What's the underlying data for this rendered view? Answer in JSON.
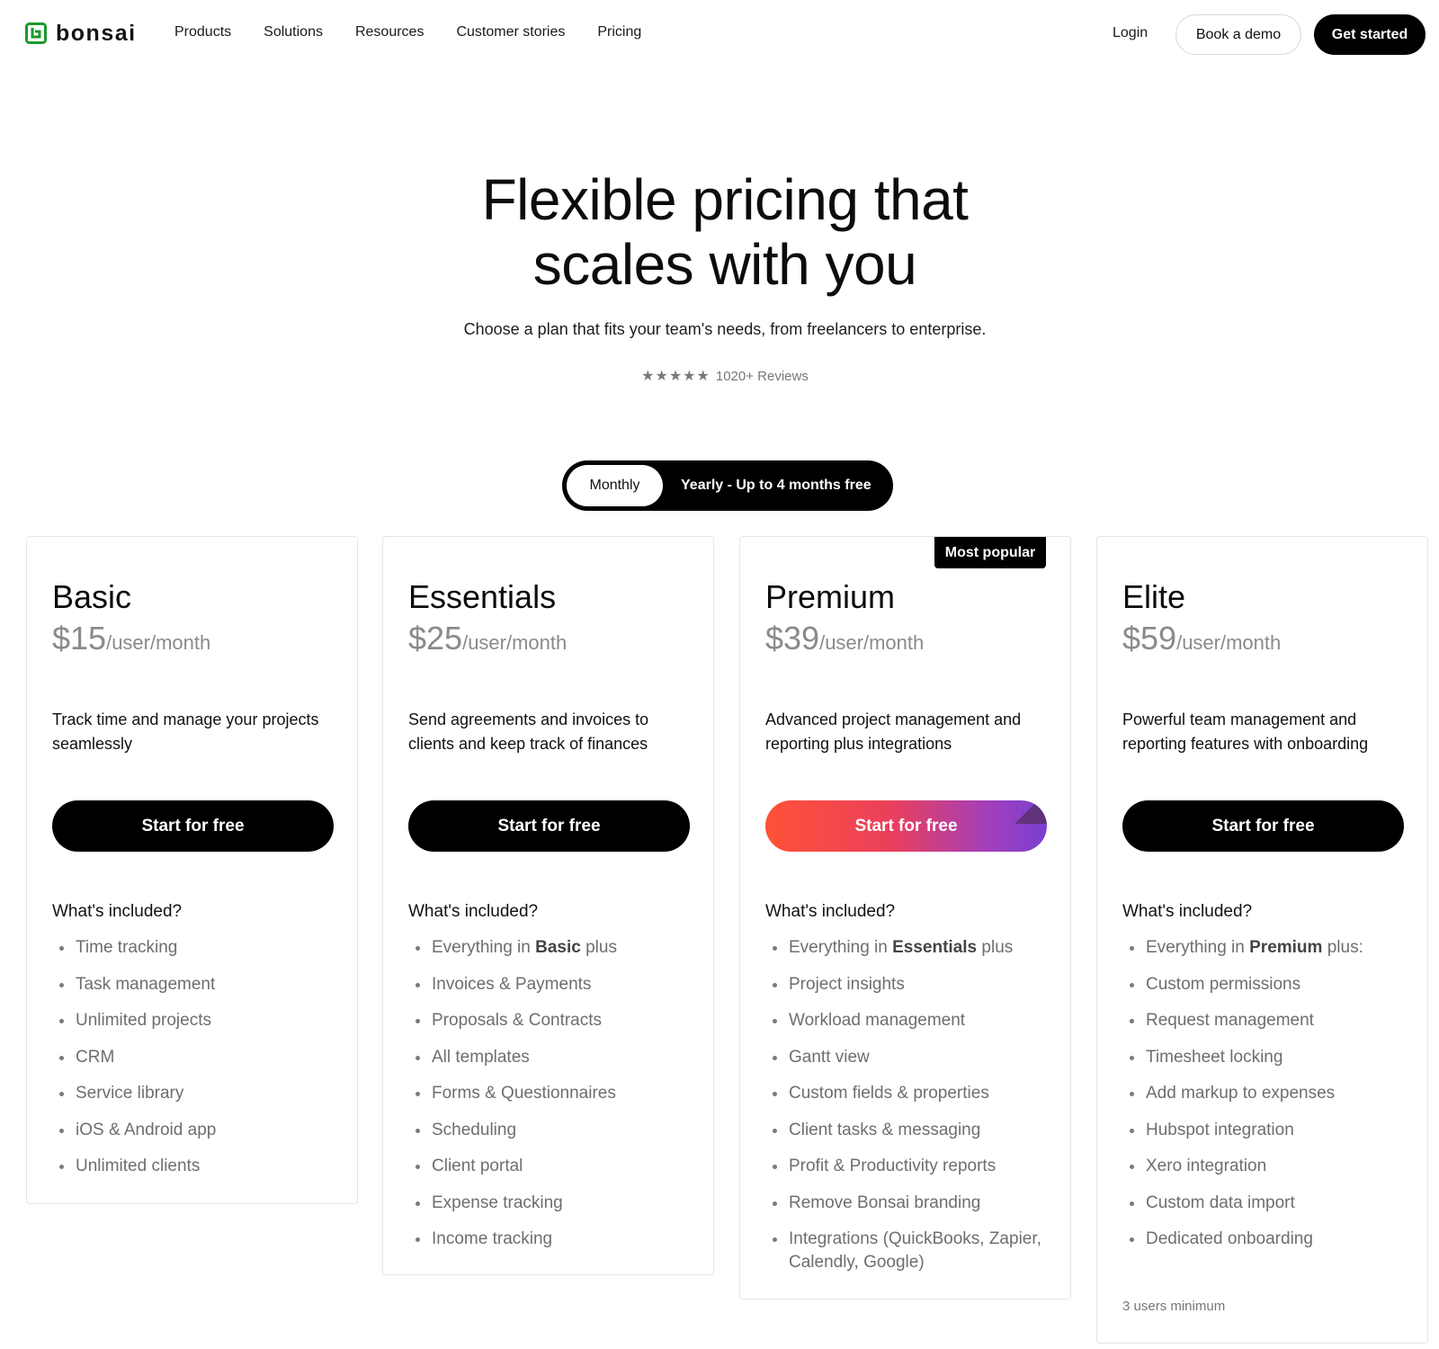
{
  "brand": {
    "name": "bonsai",
    "color": "#1a9a2a"
  },
  "nav": {
    "links": [
      "Products",
      "Solutions",
      "Resources",
      "Customer stories",
      "Pricing"
    ],
    "login": "Login",
    "book_demo": "Book a demo",
    "get_started": "Get started"
  },
  "hero": {
    "title_line1": "Flexible pricing that",
    "title_line2": "scales with you",
    "subtitle": "Choose a plan that fits your team's needs, from freelancers to enterprise.",
    "stars": "★★★★★",
    "rating": 5,
    "reviews": "1020+ Reviews"
  },
  "billing_toggle": {
    "monthly": "Monthly",
    "yearly": "Yearly - Up to 4 months free",
    "selected": "Monthly"
  },
  "plans": [
    {
      "name": "Basic",
      "price": "$15",
      "unit": "/user/month",
      "description": "Track time and manage your projects seamlessly",
      "cta": "Start for free",
      "included_title": "What's included?",
      "features": [
        "Time tracking",
        "Task management",
        "Unlimited projects",
        "CRM",
        "Service library",
        "iOS & Android app",
        "Unlimited clients"
      ]
    },
    {
      "name": "Essentials",
      "price": "$25",
      "unit": "/user/month",
      "description": "Send agreements and invoices to clients and keep track of finances",
      "cta": "Start for free",
      "included_title": "What's included?",
      "features_lead": {
        "prefix": "Everything in ",
        "bold": "Basic",
        "suffix": " plus"
      },
      "features": [
        "Invoices & Payments",
        "Proposals & Contracts",
        "All templates",
        "Forms & Questionnaires",
        "Scheduling",
        "Client portal",
        "Expense tracking",
        "Income tracking"
      ]
    },
    {
      "name": "Premium",
      "badge": "Most popular",
      "price": "$39",
      "unit": "/user/month",
      "description": "Advanced project management and reporting plus integrations",
      "cta": "Start for free",
      "included_title": "What's included?",
      "features_lead": {
        "prefix": "Everything in ",
        "bold": "Essentials",
        "suffix": " plus"
      },
      "features": [
        "Project insights",
        "Workload management",
        "Gantt view",
        "Custom fields & properties",
        "Client tasks & messaging",
        "Profit & Productivity reports",
        "Remove Bonsai branding",
        "Integrations (QuickBooks, Zapier, Calendly, Google)"
      ]
    },
    {
      "name": "Elite",
      "price": "$59",
      "unit": "/user/month",
      "description": "Powerful team management and reporting features with onboarding",
      "cta": "Start for free",
      "included_title": "What's included?",
      "features_lead": {
        "prefix": "Everything in ",
        "bold": "Premium",
        "suffix": " plus:"
      },
      "features": [
        "Custom permissions",
        "Request management",
        "Timesheet locking",
        "Add markup to expenses",
        "Hubspot integration",
        "Xero integration",
        "Custom data import",
        "Dedicated onboarding"
      ],
      "footnote": "3 users minimum"
    }
  ]
}
